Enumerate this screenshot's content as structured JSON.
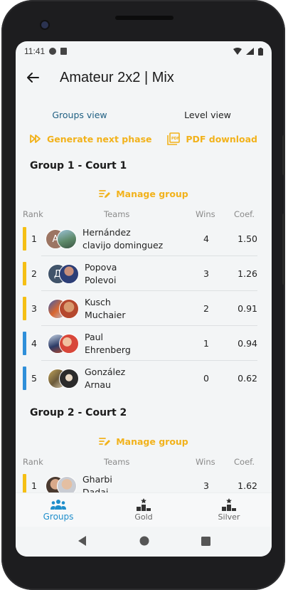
{
  "status": {
    "time": "11:41"
  },
  "appbar": {
    "title": "Amateur 2x2 | Mix"
  },
  "tabs": [
    {
      "label": "Groups view",
      "active": true
    },
    {
      "label": "Level view",
      "active": false
    }
  ],
  "actions": {
    "generate": "Generate next phase",
    "pdf": "PDF download"
  },
  "colors": {
    "accent": "#f2b21b",
    "tab_active": "#1f5f82",
    "nav_active": "#1f8ecb",
    "bar_yellow": "#f5bf14",
    "bar_blue": "#2f8fd9"
  },
  "table_headers": {
    "rank": "Rank",
    "teams": "Teams",
    "wins": "Wins",
    "coef": "Coef."
  },
  "groups": [
    {
      "title": "Group 1 - Court 1",
      "manage_label": "Manage group",
      "rows": [
        {
          "rank": "1",
          "player1": "Hernández",
          "player2": "clavijo dominguez",
          "wins": "4",
          "coef": "1.50",
          "bar": "yellow",
          "avatar1": "A"
        },
        {
          "rank": "2",
          "player1": "Popova",
          "player2": "Polevoi",
          "wins": "3",
          "coef": "1.26",
          "bar": "yellow",
          "avatar1": "Д"
        },
        {
          "rank": "3",
          "player1": "Kusch",
          "player2": "Muchaier",
          "wins": "2",
          "coef": "0.91",
          "bar": "yellow"
        },
        {
          "rank": "4",
          "player1": "Paul",
          "player2": "Ehrenberg",
          "wins": "1",
          "coef": "0.94",
          "bar": "blue"
        },
        {
          "rank": "5",
          "player1": "González",
          "player2": "Arnau",
          "wins": "0",
          "coef": "0.62",
          "bar": "blue"
        }
      ]
    },
    {
      "title": "Group 2 - Court 2",
      "manage_label": "Manage group",
      "rows": [
        {
          "rank": "1",
          "player1": "Gharbi",
          "player2": "Dadai",
          "wins": "3",
          "coef": "1.62",
          "bar": "yellow"
        }
      ]
    }
  ],
  "bottom_nav": [
    {
      "label": "Groups",
      "icon": "groups-icon",
      "active": true
    },
    {
      "label": "Gold",
      "icon": "podium-icon",
      "active": false
    },
    {
      "label": "Silver",
      "icon": "podium-icon",
      "active": false
    }
  ],
  "system_nav": {
    "back": "back-triangle-icon",
    "home": "home-circle-icon",
    "recents": "recents-square-icon"
  }
}
